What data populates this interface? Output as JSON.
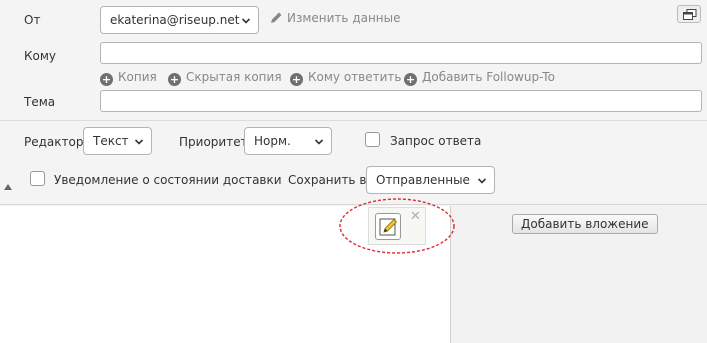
{
  "from": {
    "label": "От",
    "value": "ekaterina@riseup.net",
    "edit_link": "Изменить данные"
  },
  "to": {
    "label": "Кому",
    "value": ""
  },
  "recipients_links": [
    "Копия",
    "Скрытая копия",
    "Кому ответить",
    "Добавить Followup-To"
  ],
  "subject": {
    "label": "Тема",
    "value": ""
  },
  "options": {
    "editor_label": "Редактор",
    "editor_value": "Текст",
    "priority_label": "Приоритет",
    "priority_value": "Норм.",
    "receipt_label": "Запрос ответа",
    "receipt_checked": false,
    "dsn_label": "Уведомление о состоянии доставки",
    "dsn_checked": false,
    "save_in_label": "Сохранить в",
    "save_in_value": "Отправленные"
  },
  "attachments": {
    "add_button": "Добавить вложение"
  },
  "widget": {
    "close": "✕"
  },
  "icons": {
    "popout": "popout-window-icon",
    "edit": "pencil-icon",
    "plus": "plus-circle-icon",
    "collapse": "triangle-up-icon",
    "chevron": "chevron-down-icon",
    "editor_widget": "pencil-edit-icon"
  },
  "colors": {
    "annotation_ellipse": "#e0282e"
  }
}
